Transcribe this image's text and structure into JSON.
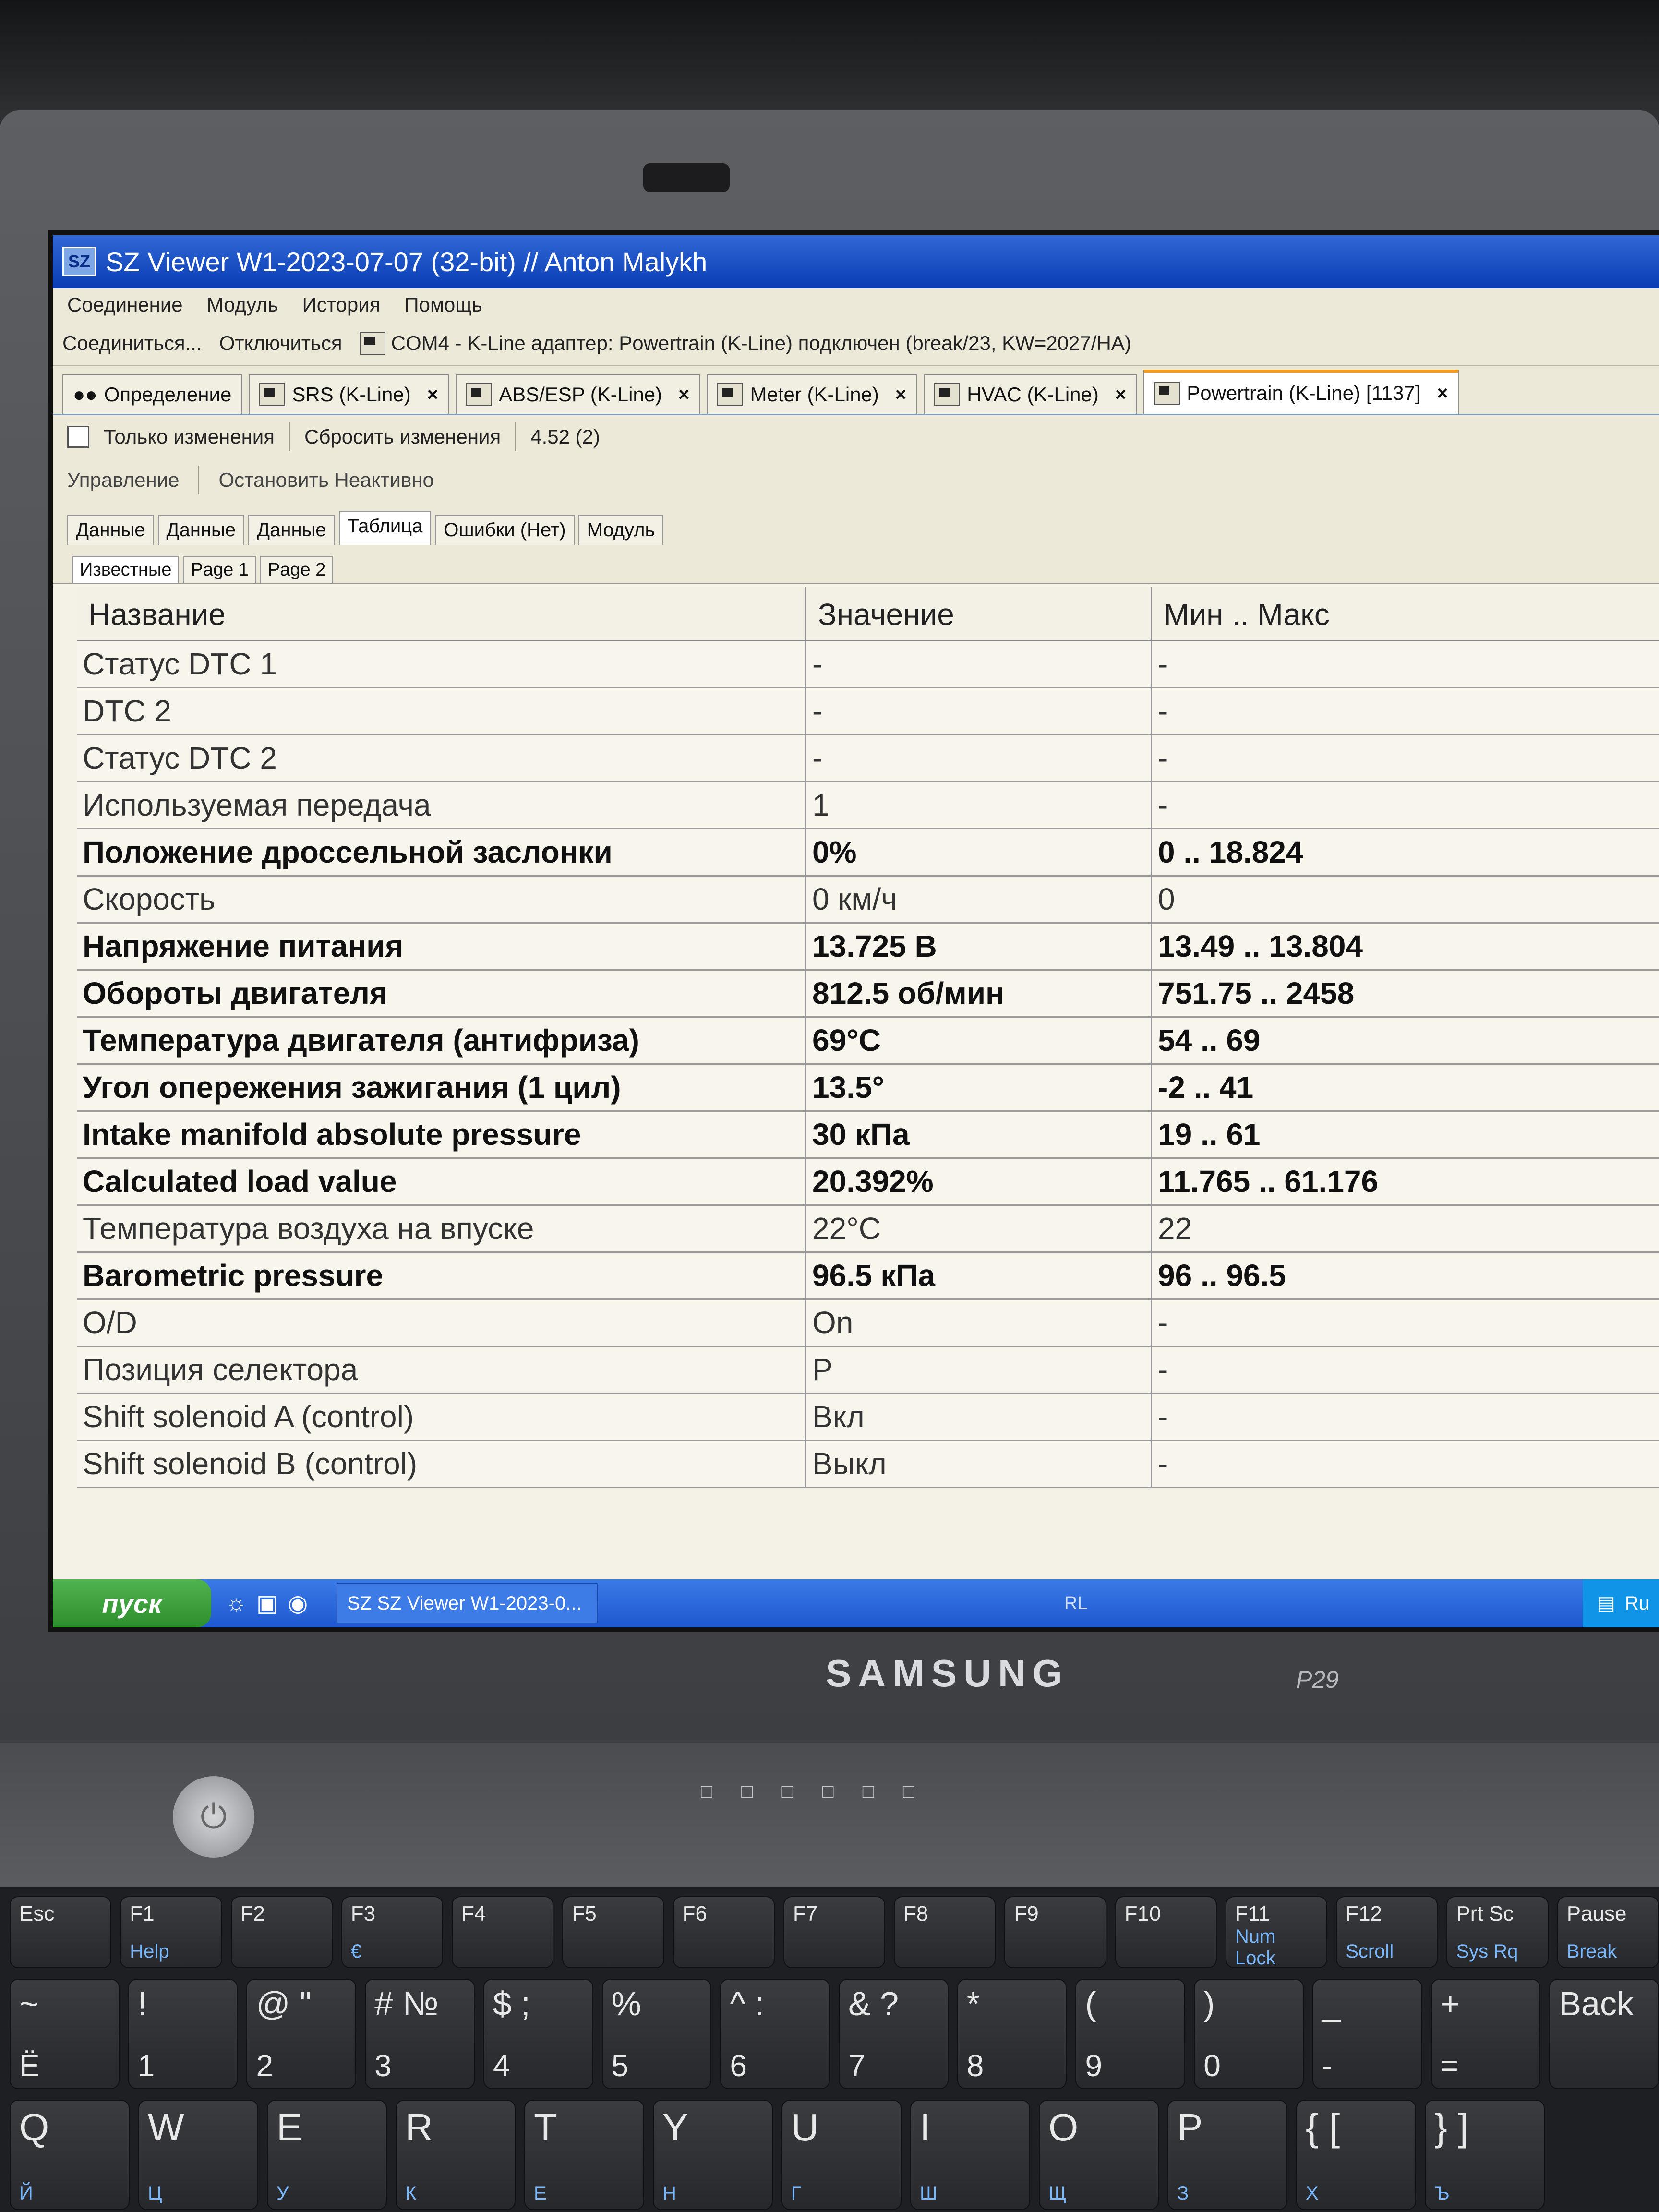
{
  "window": {
    "icon_text": "SZ",
    "title": "SZ Viewer W1-2023-07-07 (32-bit) // Anton Malykh"
  },
  "menu": [
    "Соединение",
    "Модуль",
    "История",
    "Помощь"
  ],
  "toolbar": {
    "connect": "Соединиться...",
    "disconnect": "Отключиться",
    "connection_status": "COM4 - K-Line адаптер: Powertrain (K-Line) подключен (break/23, KW=2027/HA)"
  },
  "module_tabs": [
    {
      "label": "Определение",
      "closable": false
    },
    {
      "label": "SRS (K-Line)",
      "closable": true
    },
    {
      "label": "ABS/ESP (K-Line)",
      "closable": true
    },
    {
      "label": "Meter (K-Line)",
      "closable": true
    },
    {
      "label": "HVAC (K-Line)",
      "closable": true
    },
    {
      "label": "Powertrain (K-Line) [1137]",
      "closable": true,
      "active": true
    }
  ],
  "subtoolbar": {
    "only_changes": "Только изменения",
    "reset_changes": "Сбросить изменения",
    "version": "4.52 (2)"
  },
  "control": {
    "label": "Управление",
    "stop": "Остановить Неактивно"
  },
  "view_tabs": [
    "Данные",
    "Данные",
    "Данные",
    "Таблица",
    "Ошибки (Нет)",
    "Модуль"
  ],
  "active_view_tab": 3,
  "page_tabs": [
    "Известные",
    "Page 1",
    "Page 2"
  ],
  "table": {
    "headers": [
      "Название",
      "Значение",
      "Мин .. Макс"
    ],
    "rows": [
      {
        "name": "Статус DTC 1",
        "value": "-",
        "range": "-",
        "bold": false
      },
      {
        "name": "DTC 2",
        "value": "-",
        "range": "-",
        "bold": false
      },
      {
        "name": "Статус DTC 2",
        "value": "-",
        "range": "-",
        "bold": false
      },
      {
        "name": "Используемая передача",
        "value": "1",
        "range": "-",
        "bold": false
      },
      {
        "name": "Положение дроссельной заслонки",
        "value": "0%",
        "range": "0 .. 18.824",
        "bold": true
      },
      {
        "name": "Скорость",
        "value": "0 км/ч",
        "range": "0",
        "bold": false
      },
      {
        "name": "Напряжение питания",
        "value": "13.725 В",
        "range": "13.49 .. 13.804",
        "bold": true
      },
      {
        "name": "Обороты двигателя",
        "value": "812.5 об/мин",
        "range": "751.75 .. 2458",
        "bold": true
      },
      {
        "name": "Температура двигателя (антифриза)",
        "value": "69°C",
        "range": "54 .. 69",
        "bold": true
      },
      {
        "name": "Угол опережения зажигания (1 цил)",
        "value": "13.5°",
        "range": "-2 .. 41",
        "bold": true
      },
      {
        "name": "Intake manifold absolute pressure",
        "value": "30 кПа",
        "range": "19 .. 61",
        "bold": true
      },
      {
        "name": "Calculated load value",
        "value": "20.392%",
        "range": "11.765 .. 61.176",
        "bold": true
      },
      {
        "name": "Температура воздуха на впуске",
        "value": "22°C",
        "range": "22",
        "bold": false
      },
      {
        "name": "Barometric pressure",
        "value": "96.5 кПа",
        "range": "96 .. 96.5",
        "bold": true
      },
      {
        "name": "O/D",
        "value": "On",
        "range": "-",
        "bold": false
      },
      {
        "name": "Позиция селектора",
        "value": "P",
        "range": "-",
        "bold": false
      },
      {
        "name": "Shift solenoid A (control)",
        "value": "Вкл",
        "range": "-",
        "bold": false
      },
      {
        "name": "Shift solenoid B (control)",
        "value": "Выкл",
        "range": "-",
        "bold": false
      }
    ]
  },
  "taskbar": {
    "start": "пуск",
    "task": "SZ SZ Viewer W1-2023-0...",
    "lang": "RL",
    "tray_text": "Ru"
  },
  "laptop": {
    "brand": "SAMSUNG",
    "model": "P29"
  },
  "keyboard": {
    "frow": [
      {
        "top": "Esc",
        "sub": ""
      },
      {
        "top": "F1",
        "sub": "Help"
      },
      {
        "top": "F2",
        "sub": ""
      },
      {
        "top": "F3",
        "sub": "€"
      },
      {
        "top": "F4",
        "sub": ""
      },
      {
        "top": "F5",
        "sub": ""
      },
      {
        "top": "F6",
        "sub": ""
      },
      {
        "top": "F7",
        "sub": ""
      },
      {
        "top": "F8",
        "sub": ""
      },
      {
        "top": "F9",
        "sub": ""
      },
      {
        "top": "F10",
        "sub": ""
      },
      {
        "top": "F11",
        "sub": "Num Lock"
      },
      {
        "top": "F12",
        "sub": "Scroll"
      },
      {
        "top": "Prt Sc",
        "sub": "Sys Rq"
      },
      {
        "top": "Pause",
        "sub": "Break"
      }
    ],
    "nrow": [
      {
        "top": "~",
        "sub": "Ё"
      },
      {
        "top": "!",
        "sub": "1"
      },
      {
        "top": "@ \"",
        "sub": "2"
      },
      {
        "top": "# №",
        "sub": "3"
      },
      {
        "top": "$ ;",
        "sub": "4"
      },
      {
        "top": "%",
        "sub": "5"
      },
      {
        "top": "^ :",
        "sub": "6"
      },
      {
        "top": "& ?",
        "sub": "7"
      },
      {
        "top": "*",
        "sub": "8"
      },
      {
        "top": "(",
        "sub": "9"
      },
      {
        "top": ")",
        "sub": "0"
      },
      {
        "top": "_",
        "sub": "-"
      },
      {
        "top": "+",
        "sub": "="
      },
      {
        "top": "Back",
        "sub": ""
      }
    ],
    "qrow": [
      {
        "top": "Q",
        "sub": "Й"
      },
      {
        "top": "W",
        "sub": "Ц"
      },
      {
        "top": "E",
        "sub": "У"
      },
      {
        "top": "R",
        "sub": "К"
      },
      {
        "top": "T",
        "sub": "Е"
      },
      {
        "top": "Y",
        "sub": "Н"
      },
      {
        "top": "U",
        "sub": "Г"
      },
      {
        "top": "I",
        "sub": "Ш"
      },
      {
        "top": "O",
        "sub": "Щ"
      },
      {
        "top": "P",
        "sub": "З"
      },
      {
        "top": "{ [",
        "sub": "Х"
      },
      {
        "top": "} ]",
        "sub": "Ъ"
      }
    ]
  }
}
